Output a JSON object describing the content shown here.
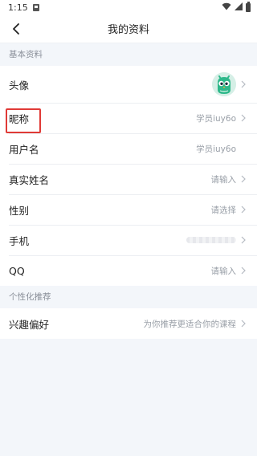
{
  "status_bar": {
    "time": "1:15"
  },
  "header": {
    "title": "我的资料"
  },
  "sections": [
    {
      "title": "基本资料",
      "rows": [
        {
          "label": "头像",
          "value": ""
        },
        {
          "label": "昵称",
          "value": "学员iuy6o"
        },
        {
          "label": "用户名",
          "value": "学员iuy6o"
        },
        {
          "label": "真实姓名",
          "value": "请输入"
        },
        {
          "label": "性别",
          "value": "请选择"
        },
        {
          "label": "手机",
          "value": ""
        },
        {
          "label": "QQ",
          "value": "请输入"
        }
      ]
    },
    {
      "title": "个性化推荐",
      "rows": [
        {
          "label": "兴趣偏好",
          "value": "为你推荐更适合你的课程"
        }
      ]
    }
  ],
  "colors": {
    "highlight": "#e03a36",
    "background": "#f3f6fa",
    "avatar_green": "#2db88a"
  }
}
